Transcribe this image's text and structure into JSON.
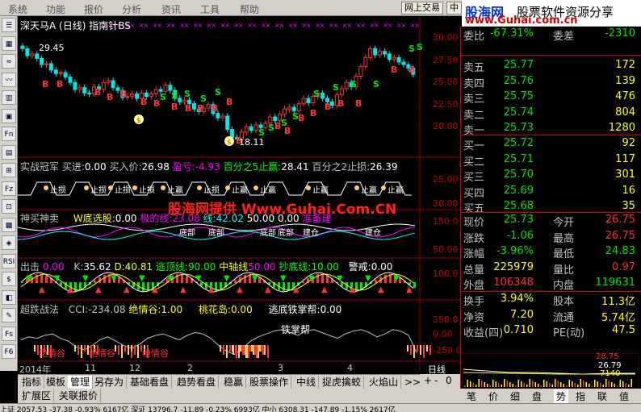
{
  "menu": [
    "系统",
    "功能",
    "报价",
    "分析",
    "资讯",
    "工具",
    "帮助"
  ],
  "top_buttons": {
    "online_trade": "网上交易",
    "mid": "中"
  },
  "logo": {
    "line1_a": "股海网",
    "line1_b": "股票软件资源分享",
    "line2": "www.Guhai.com.cn"
  },
  "watermark": "股海网提供 Www.Guhai.Com.CN",
  "left_toolbar": [
    "☰",
    "▦",
    "≈",
    "〰",
    "▥",
    "▣",
    "Fn",
    "▤",
    "⊞",
    "Fz",
    "⊡",
    "▩",
    "◈",
    "RSI",
    "$",
    "◧",
    "✎",
    "Fs",
    "F6"
  ],
  "main_panel": {
    "title": "深天马A (日线) 指南针BS",
    "peak_label": "29.45",
    "low_label": "18.11",
    "axis": [
      "30.00",
      "27.50",
      "25.00",
      "22.50",
      "20.00"
    ],
    "marker_s": "S",
    "marker_b": "B",
    "marker_dollar": "$"
  },
  "panel2": {
    "name": "实战冠军",
    "buy_in_label": "买进:",
    "buy_in": "0.00",
    "buy_price_label": "买入价:",
    "buy_price": "26.98",
    "pl_label": "盈亏:",
    "pl": "-4.93",
    "tp5_label": "百分之5止赢:",
    "tp5": "28.41",
    "sl2_label": "百分之2止损:",
    "sl2": "26.39",
    "axis": [
      "25.00",
      "20.00"
    ],
    "stop_loss": "止损",
    "take_profit": "止赢"
  },
  "panel3": {
    "name": "神买神卖",
    "wbottom_label": "W底选股:",
    "wbottom": "0.00",
    "bull_label": "极的线:",
    "bull": "23.08",
    "v2_label": "线:",
    "v2": "42.02",
    "v3": "50.00",
    "v4": "0.00",
    "warn": "准备建",
    "axis": [
      "150.0",
      "50.00"
    ],
    "bottom_word": "底部",
    "build_word": "建仓"
  },
  "panel4": {
    "name": "出击",
    "v0": "0.00",
    "k_label": "K:",
    "k": "35.62",
    "d_label": "D:",
    "d": "40.81",
    "top_label": "逃顶线:",
    "top": "90.00",
    "mid_label": "中轴线",
    "mid": "50.00",
    "bot_label": "抄底线:",
    "bot": "10.00",
    "alert_label": "警戒:",
    "alert": "0.00",
    "axis": [
      "100.0"
    ]
  },
  "panel5": {
    "name": "超跌战法",
    "cci_label": "CCI:",
    "cci": "-234.08",
    "gl_label": "绝情谷:",
    "gl": "1.00",
    "th_label": "桃花岛:",
    "th": "0.00",
    "tb_label": "逃底铁掌帮:",
    "tb": "0.00",
    "axis": [
      "250.0",
      "0.00",
      "-250.0"
    ],
    "iron_word": "铁掌帮",
    "valley_word": "绝情谷"
  },
  "date_axis": {
    "y2014": "2014年",
    "m11": "11",
    "m12": "12",
    "m2": "2",
    "m3": "3",
    "m4": "4",
    "period": "日线"
  },
  "tabs": [
    "指标",
    "模板",
    "管理",
    "另存为",
    "基础看盘",
    "趋势看盘",
    "稳赢",
    "股票操作",
    "中线",
    "捉虎擒蛟",
    "火焰山",
    ">>"
  ],
  "tabs_row2": [
    "扩展区",
    "关联报价"
  ],
  "quote": {
    "weibi_label": "委比",
    "weibi": "-67.31%",
    "weicha_label": "委差",
    "weicha": "-2310",
    "asks": [
      {
        "label": "卖五",
        "price": "25.77",
        "vol": "172"
      },
      {
        "label": "卖四",
        "price": "25.76",
        "vol": "139"
      },
      {
        "label": "卖三",
        "price": "25.75",
        "vol": "476"
      },
      {
        "label": "卖二",
        "price": "25.74",
        "vol": "804"
      },
      {
        "label": "卖一",
        "price": "25.73",
        "vol": "1280"
      }
    ],
    "bids": [
      {
        "label": "买一",
        "price": "25.72",
        "vol": "92"
      },
      {
        "label": "买二",
        "price": "25.71",
        "vol": "117"
      },
      {
        "label": "买三",
        "price": "25.70",
        "vol": "301"
      },
      {
        "label": "买四",
        "price": "25.69",
        "vol": "16"
      },
      {
        "label": "买五",
        "price": "25.68",
        "vol": "35"
      }
    ],
    "rows": [
      {
        "k1": "现价",
        "v1": "25.73",
        "k2": "今开",
        "v2": "26.75"
      },
      {
        "k1": "涨跌",
        "v1": "-1.06",
        "k2": "最高",
        "v2": "26.75"
      },
      {
        "k1": "涨幅",
        "v1": "-3.96%",
        "k2": "最低",
        "v2": "24.83"
      },
      {
        "k1": "总量",
        "v1": "225979",
        "k2": "量比",
        "v2": "0.97"
      },
      {
        "k1": "外盘",
        "v1": "106348",
        "k2": "内盘",
        "v2": "119631"
      }
    ],
    "rows2": [
      {
        "k1": "换手",
        "v1": "3.94%",
        "k2": "股本",
        "v2": "11.3亿"
      },
      {
        "k1": "净资",
        "v1": "7.20",
        "k2": "流通",
        "v2": "5.74亿"
      },
      {
        "k1": "收益(四)",
        "v1": "0.710",
        "k2": "PE(动)",
        "v2": "47.5"
      }
    ],
    "mini": {
      "hi": "28.75",
      "mid": "26.79",
      "vol": "7140"
    }
  },
  "right_tabs": [
    "笔",
    "价",
    "细",
    "盘",
    "势",
    "指",
    "联",
    "值"
  ],
  "status_text": "上证 2057.53  -37.38  -0.93%  6167亿  深证 13796.7  -11.89  -0.23%  6993亿  中小 6308.31  -147.89  -1.15%  2617亿",
  "colors": {
    "up": "#ff3232",
    "down": "#00e600",
    "yellow": "#ffff00",
    "bg": "#000000"
  }
}
